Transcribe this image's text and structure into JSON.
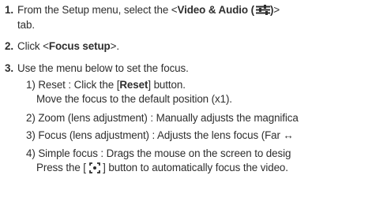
{
  "steps": {
    "s1": {
      "num": "1.",
      "pre": "From the Setup menu, select the <",
      "bold": "Video & Audio (",
      "bold_end": ")",
      "post": ">",
      "line2": "tab.",
      "icon": "sliders-icon"
    },
    "s2": {
      "num": "2.",
      "pre": "Click <",
      "bold": "Focus setup",
      "post": ">."
    },
    "s3": {
      "num": "3.",
      "text": "Use the menu below to set the focus."
    }
  },
  "substeps": {
    "a": {
      "pre": "1) Reset : Click the [",
      "bold": "Reset",
      "post": "] button.",
      "line2": "Move the focus to the default position (x1)."
    },
    "b": {
      "text": "2) Zoom (lens adjustment) : Manually adjusts the magnifica"
    },
    "c": {
      "text": "3) Focus (lens adjustment) : Adjusts the lens focus (Far ↔"
    },
    "d": {
      "text": "4) Simple focus : Drags the mouse on the screen to desig",
      "line2_pre": "Press the [ ",
      "line2_post": " ] button to automatically focus the video.",
      "icon": "focus-brackets-icon"
    }
  }
}
